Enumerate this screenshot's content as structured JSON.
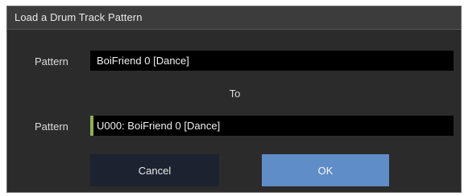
{
  "dialog": {
    "title": "Load a Drum Track Pattern",
    "source": {
      "label": "Pattern",
      "value": "BoiFriend 0 [Dance]"
    },
    "to_label": "To",
    "destination": {
      "label": "Pattern",
      "value": "U000: BoiFriend 0 [Dance]"
    },
    "cancel_label": "Cancel",
    "ok_label": "OK"
  },
  "colors": {
    "dialog_background": "#2b2b2b",
    "field_background": "#000000",
    "selection_marker": "#8fb055",
    "cancel_button": "#1c2330",
    "ok_button": "#5f8dc8"
  }
}
